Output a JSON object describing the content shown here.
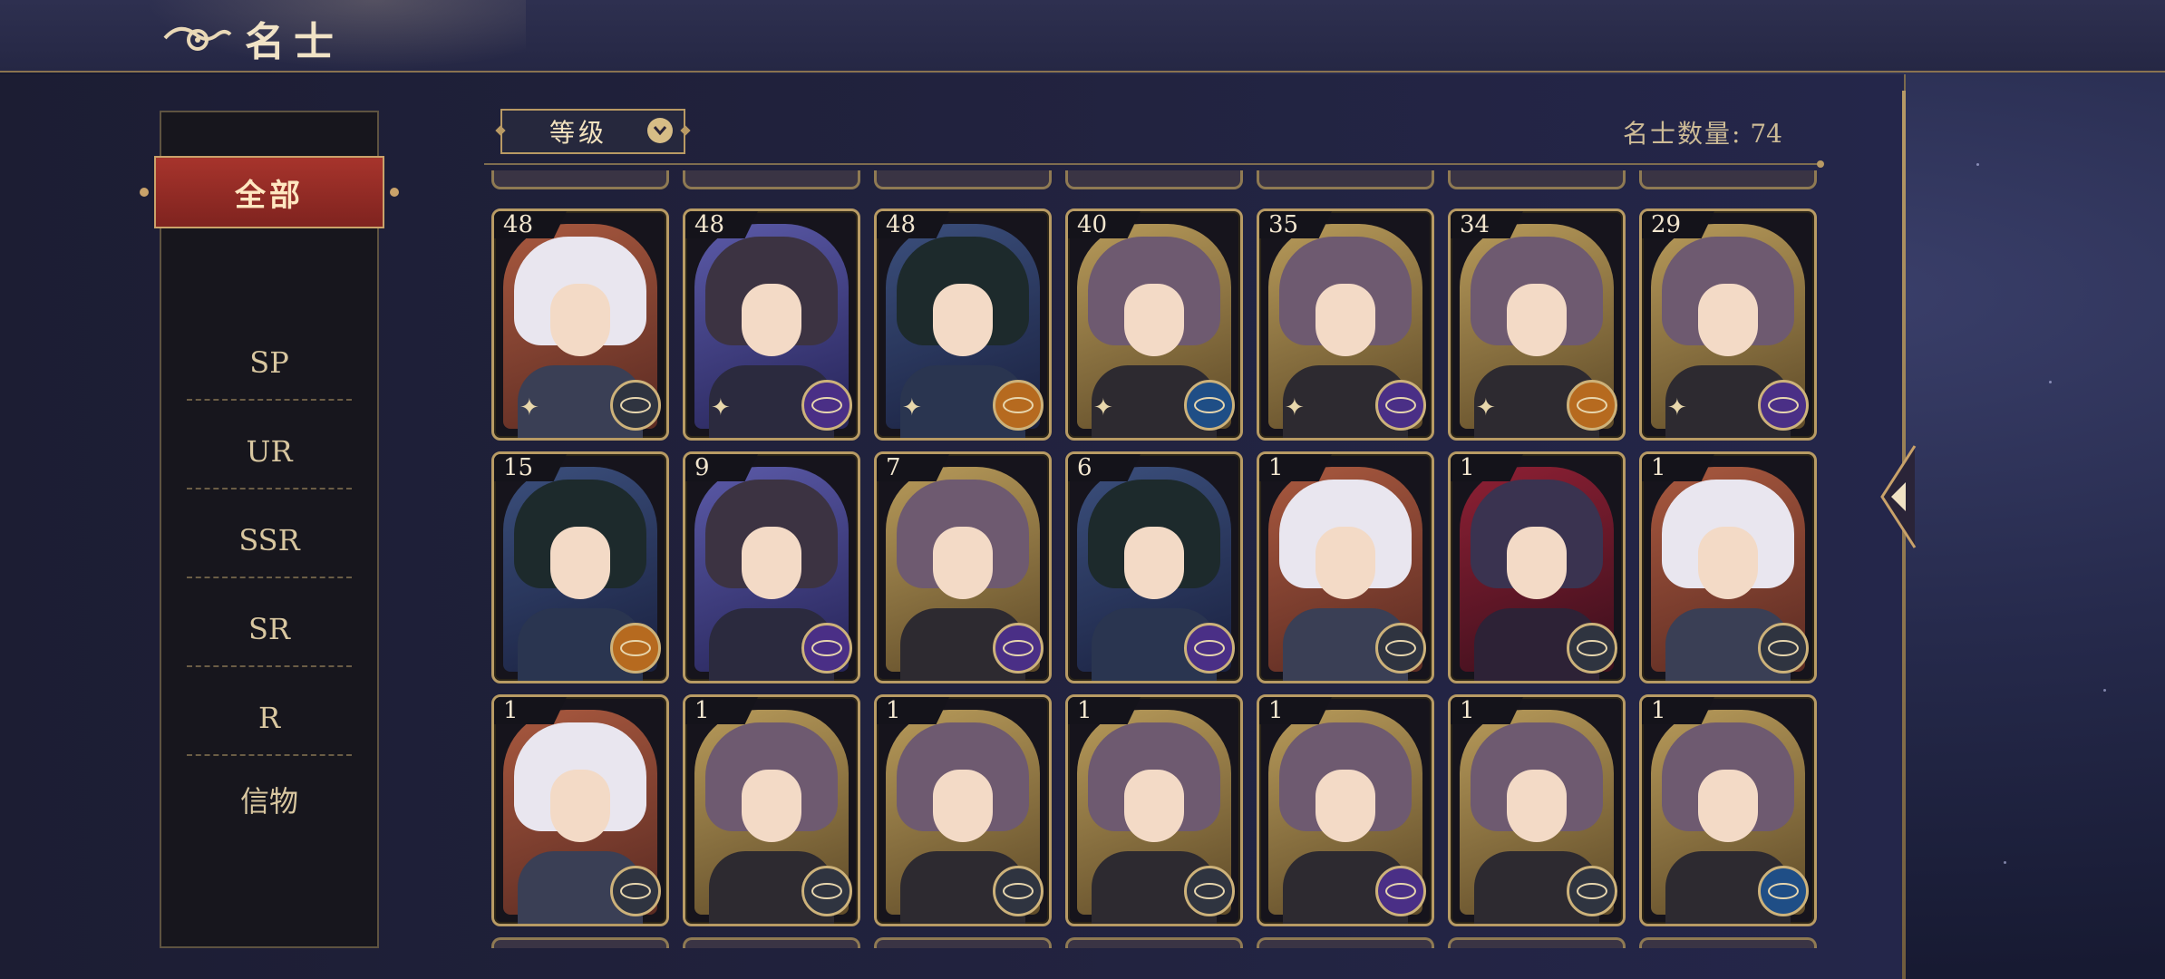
{
  "header": {
    "title": "名士"
  },
  "sidebar": {
    "items": [
      {
        "label": "全部",
        "active": true
      },
      {
        "label": "SP"
      },
      {
        "label": "UR"
      },
      {
        "label": "SSR"
      },
      {
        "label": "SR"
      },
      {
        "label": "R"
      },
      {
        "label": "信物"
      }
    ]
  },
  "toolbar": {
    "sort_label": "等级",
    "count_label": "名士数量:",
    "count_value": "74"
  },
  "colors": {
    "accent_red": "#9b2f28",
    "gold_frame": "#b89b64",
    "panel": "#1c1d33"
  },
  "cards": [
    {
      "level": "48",
      "theme": "copper",
      "emblem": "gray"
    },
    {
      "level": "48",
      "theme": "violet",
      "emblem": "purple"
    },
    {
      "level": "48",
      "theme": "navy",
      "emblem": "orange"
    },
    {
      "level": "40",
      "theme": "gold",
      "emblem": "blue"
    },
    {
      "level": "35",
      "theme": "gold",
      "emblem": "purple"
    },
    {
      "level": "34",
      "theme": "gold",
      "emblem": "orange"
    },
    {
      "level": "29",
      "theme": "gold",
      "emblem": "purple"
    },
    {
      "level": "15",
      "theme": "navy",
      "emblem": "orange"
    },
    {
      "level": "9",
      "theme": "violet",
      "emblem": "purple"
    },
    {
      "level": "7",
      "theme": "gold",
      "emblem": "purple"
    },
    {
      "level": "6",
      "theme": "navy",
      "emblem": "purple"
    },
    {
      "level": "1",
      "theme": "copper",
      "emblem": "gray"
    },
    {
      "level": "1",
      "theme": "crimson",
      "emblem": "gray"
    },
    {
      "level": "1",
      "theme": "copper",
      "emblem": "gray"
    },
    {
      "level": "1",
      "theme": "copper",
      "emblem": "gray"
    },
    {
      "level": "1",
      "theme": "gold",
      "emblem": "gray"
    },
    {
      "level": "1",
      "theme": "gold",
      "emblem": "gray"
    },
    {
      "level": "1",
      "theme": "gold",
      "emblem": "gray"
    },
    {
      "level": "1",
      "theme": "gold",
      "emblem": "purple"
    },
    {
      "level": "1",
      "theme": "gold",
      "emblem": "gray"
    },
    {
      "level": "1",
      "theme": "gold",
      "emblem": "blue"
    }
  ]
}
